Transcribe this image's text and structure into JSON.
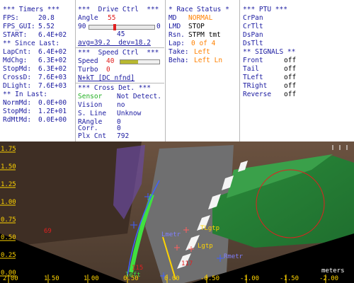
{
  "timers": {
    "title": "*** Timers ***",
    "rows": [
      {
        "k": "FPS:",
        "v": "20.8"
      },
      {
        "k": "FPS_GUI:",
        "v": "5.52"
      },
      {
        "k": "START:",
        "v": "6.4E+02"
      }
    ],
    "since_title": "** Since Last:",
    "since": [
      {
        "k": "LapCnt:",
        "v": "6.4E+02"
      },
      {
        "k": "MdChg:",
        "v": "6.3E+02"
      },
      {
        "k": "StopMd:",
        "v": "6.3E+02"
      },
      {
        "k": "CrossD:",
        "v": "7.6E+03"
      },
      {
        "k": "DLight:",
        "v": "7.6E+03"
      }
    ],
    "in_title": "** In Last:",
    "in": [
      {
        "k": "NormMd:",
        "v": "0.0E+00"
      },
      {
        "k": "StopMd:",
        "v": "1.2E+01"
      },
      {
        "k": "RdMtMd:",
        "v": "0.0E+00"
      }
    ]
  },
  "drive": {
    "title": "***  Drive Ctrl  ***",
    "angle_label": "Angle",
    "angle_value": "55",
    "slider_min": "90",
    "slider_max": "0",
    "slider_level": 0.39,
    "slider_value": "45",
    "avg": "avg=39.2  dev=18.2",
    "speed_title": "***  Speed Ctrl  ***",
    "speed_label": "Speed",
    "speed_value": "40",
    "speed_level": 0.45,
    "turbo_label": "Turbo",
    "turbo_value": "0",
    "nkt": "N+kT [DC nfnd]",
    "cross_title": "*** Cross Det. ***",
    "cross": [
      {
        "k": "Sensor",
        "v": "Not Detect."
      },
      {
        "k": "Vision",
        "v": "no"
      },
      {
        "k": "S. Line",
        "v": "Unknow"
      },
      {
        "k": "RAngle",
        "v": "0"
      },
      {
        "k": "Corr.",
        "v": "0"
      },
      {
        "k": "Plx Cnt",
        "v": "792"
      }
    ]
  },
  "race": {
    "title": "* Race Status *",
    "rows": [
      {
        "k": "MD",
        "v": "NORMAL"
      },
      {
        "k": "LMD",
        "v": "STOP"
      },
      {
        "k": "Rsn.",
        "v": "STPM tmt"
      },
      {
        "k": "Lap:",
        "v": "0 of 4"
      },
      {
        "k": "Take:",
        "v": "Left"
      },
      {
        "k": "Beha:",
        "v": "Left Ln"
      }
    ]
  },
  "ptu": {
    "title": "*** PTU ***",
    "items": [
      "CrPan",
      "CrTlt",
      "DsPan",
      "DsTlt"
    ],
    "signals_title": "** SIGNALS **",
    "signals": [
      {
        "k": "Front",
        "v": "off"
      },
      {
        "k": "Tail",
        "v": "off"
      },
      {
        "k": "TLeft",
        "v": "off"
      },
      {
        "k": "TRight",
        "v": "off"
      },
      {
        "k": "Reverse",
        "v": "off"
      }
    ]
  },
  "view": {
    "units": "meters",
    "x_ticks": [
      "2.00",
      "1.50",
      "1.00",
      "0.50",
      "0.00",
      "-0.50",
      "-1.00",
      "-1.50",
      "-2.00"
    ],
    "y_ticks": [
      "1.75",
      "1.50",
      "1.25",
      "1.00",
      "0.75",
      "0.50",
      "0.25",
      "0.00"
    ],
    "labels": {
      "tlgtp": "TLgtp",
      "lgtp": "Lgtp",
      "lmetr": "Lmetr",
      "rmetr": "Rmetr",
      "left": "left",
      "n69": "69",
      "n115": "115",
      "n117": "117"
    }
  }
}
